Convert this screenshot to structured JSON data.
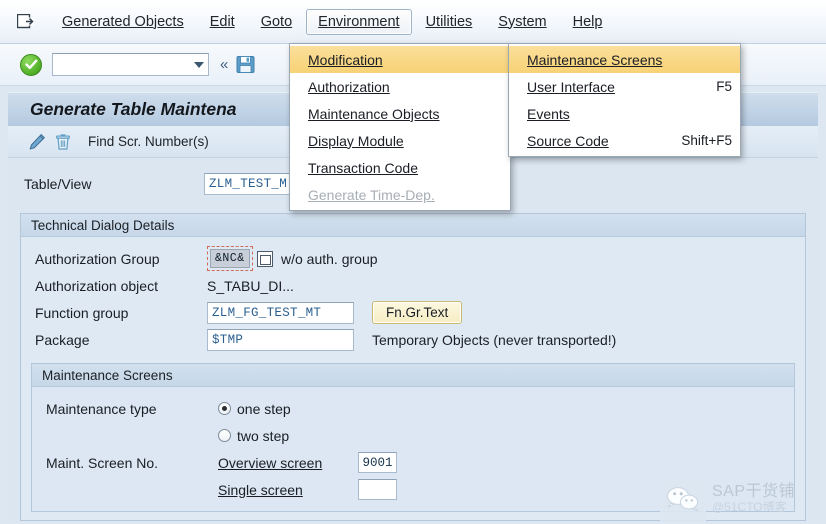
{
  "menubar": {
    "system_icon": "exit-icon",
    "items": [
      {
        "label": "Generated Objects",
        "accel_index": 2
      },
      {
        "label": "Edit",
        "accel_index": 0
      },
      {
        "label": "Goto",
        "accel_index": 0
      },
      {
        "label": "Environment",
        "accel_index": 1
      },
      {
        "label": "Utilities",
        "accel_index": 1
      },
      {
        "label": "System",
        "accel_index": 1
      },
      {
        "label": "Help",
        "accel_index": 0
      }
    ],
    "open_item": "Environment"
  },
  "toolbar": {
    "enter_icon": "green-check-icon",
    "command_value": "",
    "command_placeholder": "",
    "dropdown_icon": "chevron-down-icon",
    "collapse_icon": "double-chevron-left-icon",
    "save_icon": "save-icon"
  },
  "screen": {
    "title": "Generate Table Maintena",
    "app_toolbar": {
      "edit_icon": "pencil-icon",
      "delete_icon": "trash-icon",
      "find_label": "Find Scr. Number(s)"
    }
  },
  "form": {
    "table_view_label": "Table/View",
    "table_view_value": "ZLM_TEST_M"
  },
  "technical_group": {
    "header": "Technical Dialog Details",
    "auth_group_label": "Authorization Group",
    "auth_group_value": "&NC&",
    "auth_group_hint": "w/o auth. group",
    "auth_group_f4_icon": "value-help-icon",
    "auth_object_label": "Authorization object",
    "auth_object_value": "S_TABU_DI...",
    "function_group_label": "Function group",
    "function_group_value": "ZLM_FG_TEST_MT",
    "fn_gr_text_button": "Fn.Gr.Text",
    "package_label": "Package",
    "package_value": "$TMP",
    "package_hint": "Temporary Objects (never transported!)"
  },
  "maintenance_group": {
    "header": "Maintenance Screens",
    "maint_type_label": "Maintenance type",
    "options": [
      {
        "label": "one step",
        "selected": true
      },
      {
        "label": "two step",
        "selected": false
      }
    ],
    "screen_no_label": "Maint. Screen No.",
    "overview_screen_label": "Overview screen",
    "overview_screen_value": "9001",
    "single_screen_label": "Single screen",
    "single_screen_value": ""
  },
  "menu_environment": {
    "items": [
      {
        "label": "Modification",
        "accel_index": 0,
        "submenu": true,
        "selected": true,
        "disabled": false,
        "shortcut": ""
      },
      {
        "label": "Authorization",
        "accel_index": 0,
        "submenu": true,
        "selected": false,
        "disabled": false,
        "shortcut": ""
      },
      {
        "label": "Maintenance Objects",
        "accel_index": 1,
        "submenu": true,
        "selected": false,
        "disabled": false,
        "shortcut": ""
      },
      {
        "label": "Display Module",
        "accel_index": 0,
        "submenu": false,
        "selected": false,
        "disabled": false,
        "shortcut": ""
      },
      {
        "label": "Transaction Code",
        "accel_index": 0,
        "submenu": false,
        "selected": false,
        "disabled": false,
        "shortcut": ""
      },
      {
        "label": "Generate Time-Dep.",
        "accel_index": 0,
        "submenu": false,
        "selected": false,
        "disabled": true,
        "shortcut": ""
      }
    ]
  },
  "menu_modification": {
    "items": [
      {
        "label": "Maintenance Screens",
        "accel_index": 0,
        "submenu": false,
        "selected": true,
        "disabled": false,
        "shortcut": ""
      },
      {
        "label": "User Interface",
        "accel_index": 0,
        "submenu": false,
        "selected": false,
        "disabled": false,
        "shortcut": "F5"
      },
      {
        "label": "Events",
        "accel_index": 0,
        "submenu": false,
        "selected": false,
        "disabled": false,
        "shortcut": ""
      },
      {
        "label": "Source Code",
        "accel_index": 0,
        "submenu": false,
        "selected": false,
        "disabled": false,
        "shortcut": "Shift+F5"
      }
    ]
  },
  "watermark": {
    "icon": "wechat-icon",
    "title": "SAP干货铺",
    "subtitle": "@51CTO博客"
  },
  "colors": {
    "menu_highlight": "#f7d275",
    "window_bg": "#dce7f2",
    "accent_button": "#f6edc4",
    "field_text": "#2a5f92"
  }
}
